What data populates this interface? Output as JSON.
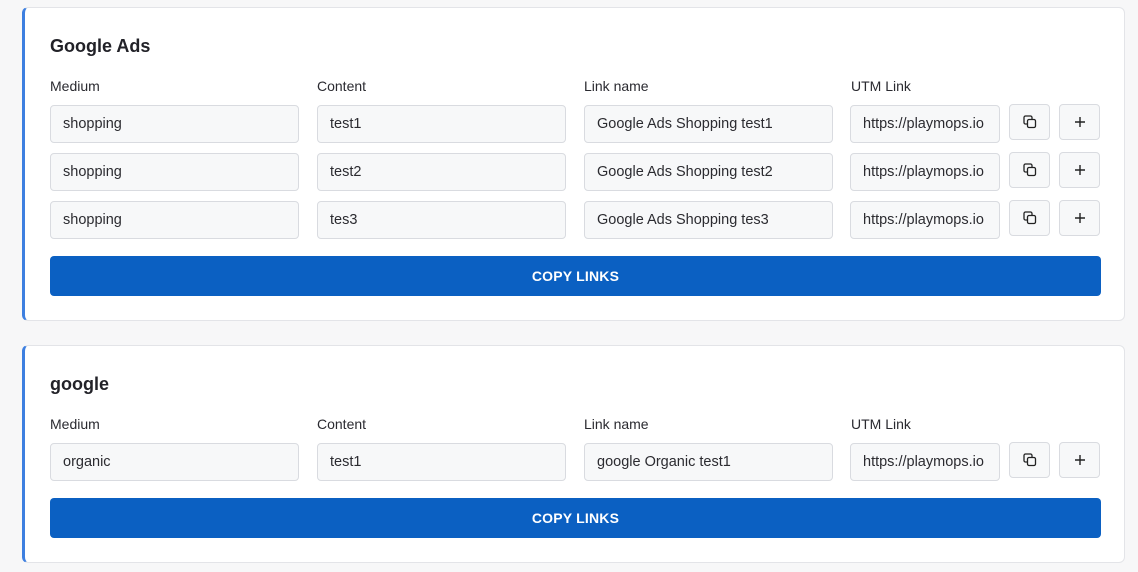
{
  "colors": {
    "accent": "#3d7fe0",
    "button": "#0b60c2"
  },
  "icons": {
    "copy": "copy-icon",
    "add": "plus-icon"
  },
  "sections": [
    {
      "title": "Google Ads",
      "headers": {
        "medium": "Medium",
        "content": "Content",
        "link_name": "Link name",
        "utm_link": "UTM Link"
      },
      "rows": [
        {
          "medium": "shopping",
          "content": "test1",
          "link_name": "Google Ads Shopping test1",
          "utm_link": "https://playmops.io"
        },
        {
          "medium": "shopping",
          "content": "test2",
          "link_name": "Google Ads Shopping test2",
          "utm_link": "https://playmops.io"
        },
        {
          "medium": "shopping",
          "content": "tes3",
          "link_name": "Google Ads Shopping tes3",
          "utm_link": "https://playmops.io"
        }
      ],
      "copy_label": "COPY LINKS"
    },
    {
      "title": "google",
      "headers": {
        "medium": "Medium",
        "content": "Content",
        "link_name": "Link name",
        "utm_link": "UTM Link"
      },
      "rows": [
        {
          "medium": "organic",
          "content": "test1",
          "link_name": "google Organic test1",
          "utm_link": "https://playmops.io"
        }
      ],
      "copy_label": "COPY LINKS"
    }
  ]
}
